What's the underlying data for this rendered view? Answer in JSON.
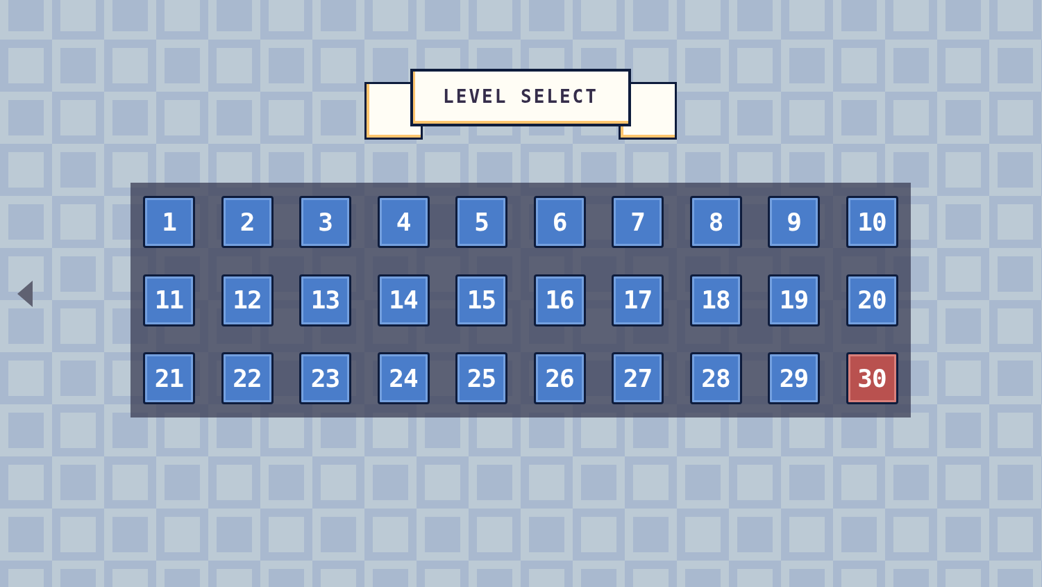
{
  "title": "LEVEL SELECT",
  "levels": [
    {
      "label": "1",
      "selected": false
    },
    {
      "label": "2",
      "selected": false
    },
    {
      "label": "3",
      "selected": false
    },
    {
      "label": "4",
      "selected": false
    },
    {
      "label": "5",
      "selected": false
    },
    {
      "label": "6",
      "selected": false
    },
    {
      "label": "7",
      "selected": false
    },
    {
      "label": "8",
      "selected": false
    },
    {
      "label": "9",
      "selected": false
    },
    {
      "label": "10",
      "selected": false
    },
    {
      "label": "11",
      "selected": false
    },
    {
      "label": "12",
      "selected": false
    },
    {
      "label": "13",
      "selected": false
    },
    {
      "label": "14",
      "selected": false
    },
    {
      "label": "15",
      "selected": false
    },
    {
      "label": "16",
      "selected": false
    },
    {
      "label": "17",
      "selected": false
    },
    {
      "label": "18",
      "selected": false
    },
    {
      "label": "19",
      "selected": false
    },
    {
      "label": "20",
      "selected": false
    },
    {
      "label": "21",
      "selected": false
    },
    {
      "label": "22",
      "selected": false
    },
    {
      "label": "23",
      "selected": false
    },
    {
      "label": "24",
      "selected": false
    },
    {
      "label": "25",
      "selected": false
    },
    {
      "label": "26",
      "selected": false
    },
    {
      "label": "27",
      "selected": false
    },
    {
      "label": "28",
      "selected": false
    },
    {
      "label": "29",
      "selected": false
    },
    {
      "label": "30",
      "selected": true
    }
  ]
}
